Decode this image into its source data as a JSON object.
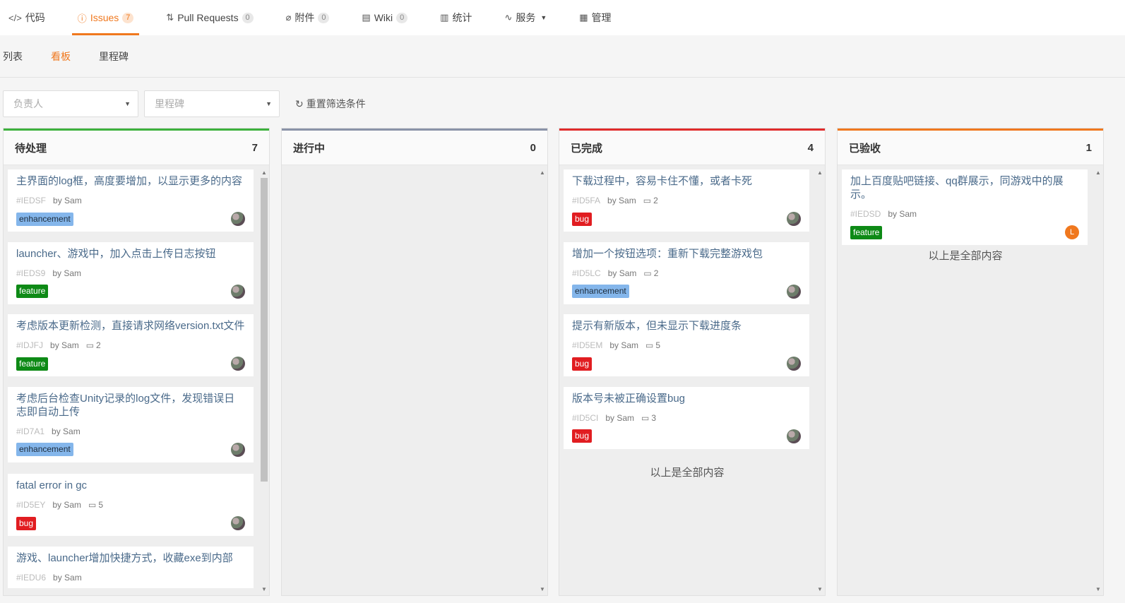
{
  "tabs": [
    {
      "icon": "code-icon",
      "glyph": "</>",
      "label": "代码",
      "count": ""
    },
    {
      "icon": "issue-icon",
      "glyph": "ⓘ",
      "label": "Issues",
      "count": "7",
      "active": true
    },
    {
      "icon": "pull-request-icon",
      "glyph": "⇅",
      "label": "Pull Requests",
      "count": "0"
    },
    {
      "icon": "attachment-icon",
      "glyph": "⌀",
      "label": "附件",
      "count": "0"
    },
    {
      "icon": "wiki-icon",
      "glyph": "▤",
      "label": "Wiki",
      "count": "0"
    },
    {
      "icon": "stats-icon",
      "glyph": "▥",
      "label": "统计",
      "count": ""
    },
    {
      "icon": "services-icon",
      "glyph": "∿",
      "label": "服务",
      "count": "",
      "dropdown": true
    },
    {
      "icon": "manage-icon",
      "glyph": "▦",
      "label": "管理",
      "count": ""
    }
  ],
  "subnav": [
    {
      "label": "列表"
    },
    {
      "label": "看板",
      "active": true
    },
    {
      "label": "里程碑"
    }
  ],
  "filters": {
    "assignee_placeholder": "负责人",
    "milestone_placeholder": "里程碑",
    "reset_label": "重置筛选条件"
  },
  "colors": {
    "accent": "#f0781e",
    "pending": "#3cb13c",
    "in_progress": "#8a93a8",
    "done": "#e02b2b",
    "accepted": "#f0781e",
    "label_enhancement_bg": "#84b6eb",
    "label_feature_bg": "#0e8a16",
    "label_bug_bg": "#e11d21"
  },
  "columns": [
    {
      "name": "待处理",
      "count": "7",
      "color": "#3cb13c",
      "scroll": true,
      "end": "",
      "cards": [
        {
          "title": "主界面的log框，高度要增加，以显示更多的内容",
          "id": "#IEDSF",
          "by": "by Sam",
          "comments": "",
          "label": "enhancement"
        },
        {
          "title": "launcher、游戏中，加入点击上传日志按钮",
          "id": "#IEDS9",
          "by": "by Sam",
          "comments": "",
          "label": "feature"
        },
        {
          "title": "考虑版本更新检测，直接请求网络version.txt文件",
          "id": "#IDJFJ",
          "by": "by Sam",
          "comments": "2",
          "label": "feature"
        },
        {
          "title": "考虑后台检查Unity记录的log文件，发现错误日志即自动上传",
          "id": "#ID7A1",
          "by": "by Sam",
          "comments": "",
          "label": "enhancement",
          "tall": true
        },
        {
          "title": "fatal error in gc",
          "id": "#ID5EY",
          "by": "by Sam",
          "comments": "5",
          "label": "bug"
        },
        {
          "title": "游戏、launcher增加快捷方式，收藏exe到内部",
          "id": "#IEDU6",
          "by": "by Sam",
          "comments": "",
          "label": ""
        }
      ]
    },
    {
      "name": "进行中",
      "count": "0",
      "color": "#8a93a8",
      "scroll": false,
      "end": "",
      "cards": []
    },
    {
      "name": "已完成",
      "count": "4",
      "color": "#e02b2b",
      "scroll": false,
      "end": "以上是全部内容",
      "cards": [
        {
          "title": "下载过程中，容易卡住不懂，或者卡死",
          "id": "#ID5FA",
          "by": "by Sam",
          "comments": "2",
          "label": "bug"
        },
        {
          "title": "增加一个按钮选项：重新下载完整游戏包",
          "id": "#ID5LC",
          "by": "by Sam",
          "comments": "2",
          "label": "enhancement"
        },
        {
          "title": "提示有新版本，但未显示下载进度条",
          "id": "#ID5EM",
          "by": "by Sam",
          "comments": "5",
          "label": "bug"
        },
        {
          "title": "版本号未被正确设置bug",
          "id": "#ID5CI",
          "by": "by Sam",
          "comments": "3",
          "label": "bug"
        }
      ]
    },
    {
      "name": "已验收",
      "count": "1",
      "color": "#f0781e",
      "scroll": false,
      "end": "以上是全部内容",
      "cards": [
        {
          "title": "加上百度贴吧链接、qq群展示，同游戏中的展示。",
          "id": "#IEDSD",
          "by": "by Sam",
          "comments": "",
          "label": "feature",
          "avatar_letter": "L"
        }
      ]
    }
  ]
}
